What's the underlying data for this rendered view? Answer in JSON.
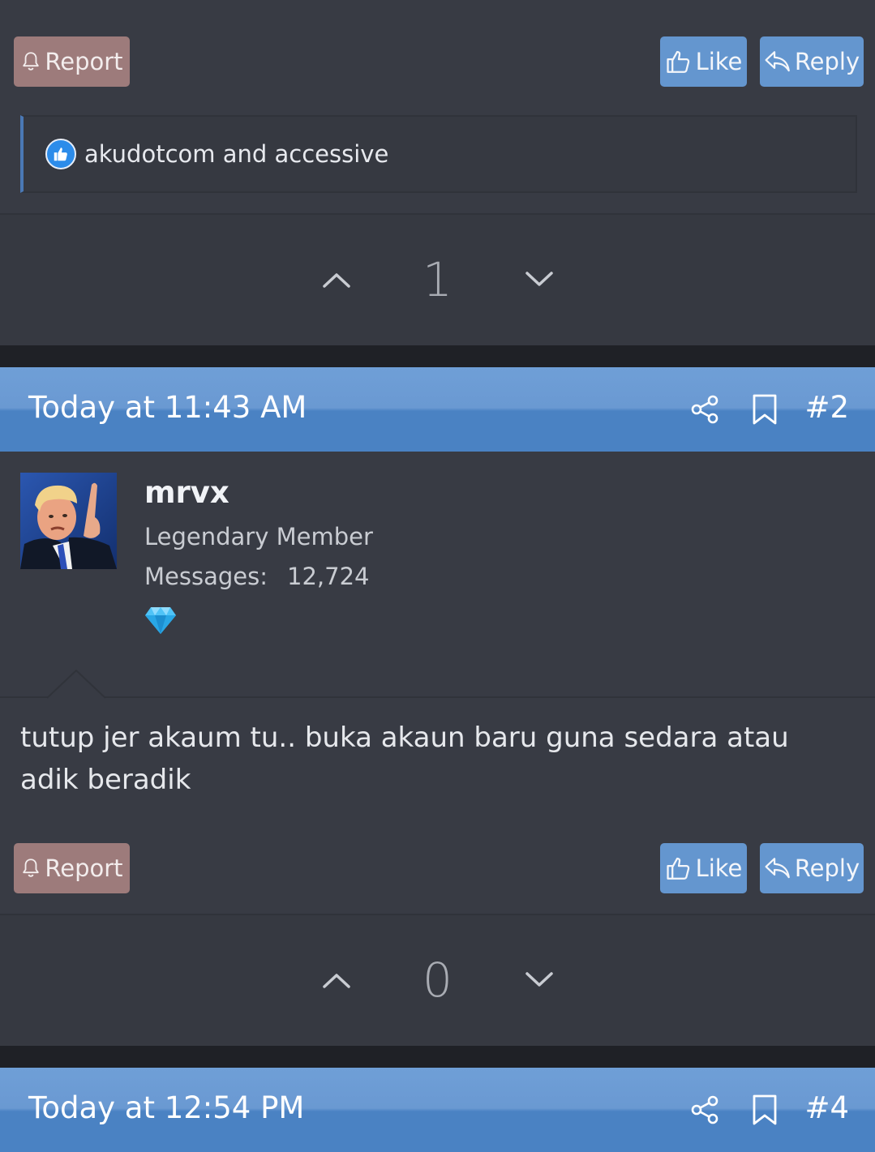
{
  "post1_actions": {
    "report_label": "Report",
    "like_label": "Like",
    "reply_label": "Reply"
  },
  "post1_likes": {
    "text": "akudotcom and accessive"
  },
  "post1_vote": {
    "score": "1"
  },
  "post2": {
    "date": "Today at 11:43 AM",
    "number": "#2",
    "username": "mrvx",
    "user_title": "Legendary Member",
    "messages_label": "Messages:",
    "messages_value": "12,724",
    "body": "tutup jer akaum tu.. buka akaun baru guna sedara atau adik beradik",
    "report_label": "Report",
    "like_label": "Like",
    "reply_label": "Reply",
    "score": "0"
  },
  "post3": {
    "date": "Today at 12:54 PM",
    "number": "#4"
  },
  "colors": {
    "header_blue": "#4a82c3",
    "button_blue": "#6496cf",
    "report_button": "#9d7b7b",
    "panel": "#383b44",
    "page_background": "#1f2126"
  }
}
